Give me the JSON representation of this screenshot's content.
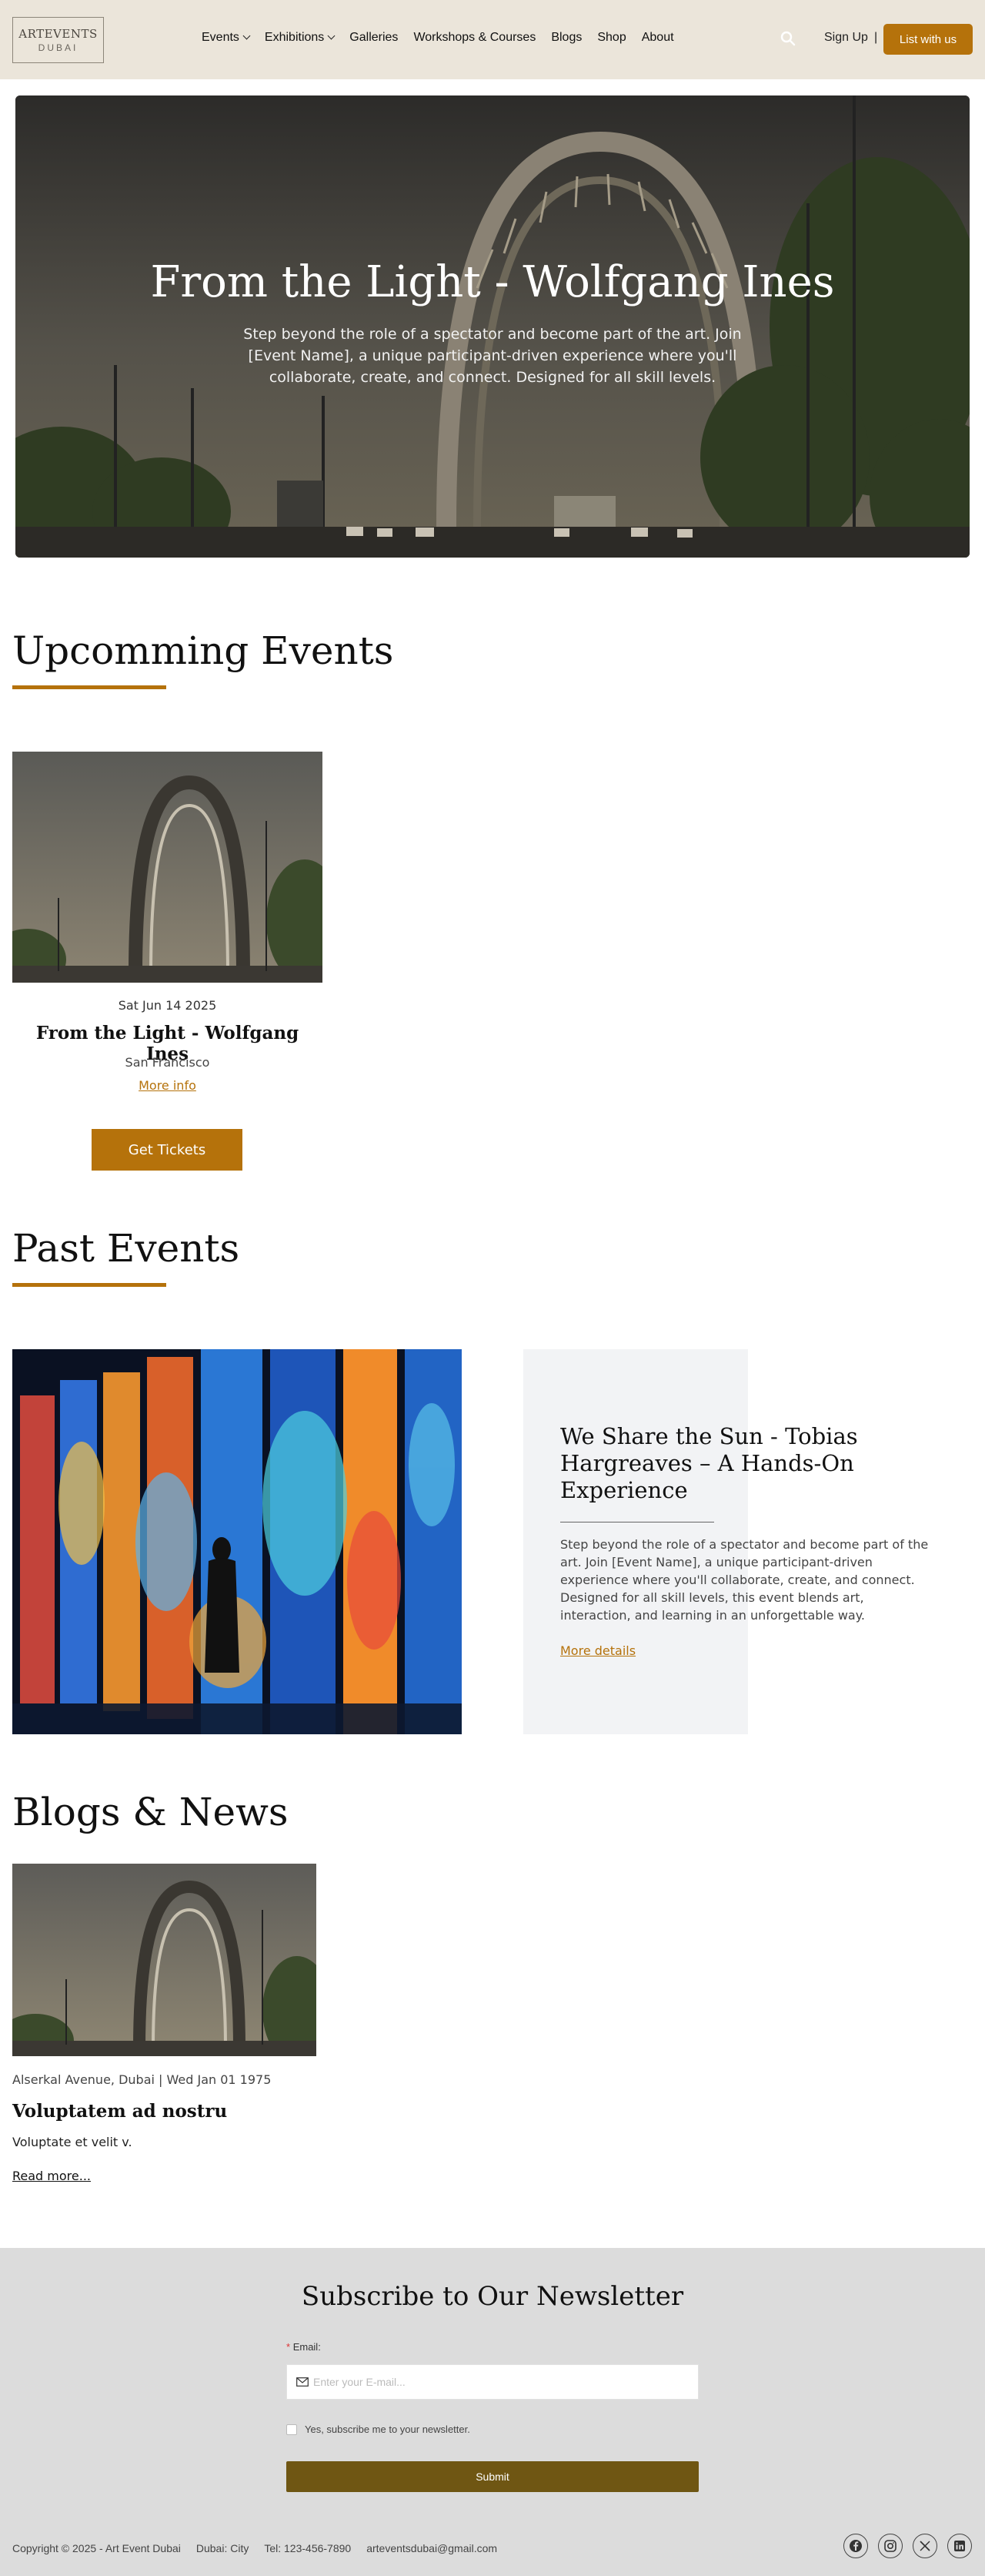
{
  "header": {
    "logo_line1": "ARTEVENTS",
    "logo_line2": "DUBAI",
    "nav": [
      "Events",
      "Exhibitions",
      "Galleries",
      "Workshops & Courses",
      "Blogs",
      "Shop",
      "About"
    ],
    "sign_up": "Sign Up",
    "separator": "|",
    "list_with_us": "List with us"
  },
  "hero": {
    "title": "From the Light - Wolfgang Ines",
    "subtitle": "Step beyond the role of a spectator and become part of the art. Join [Event Name], a unique participant-driven experience where you'll collaborate, create, and connect. Designed for all skill levels."
  },
  "upcoming": {
    "heading": "Upcomming Events",
    "card": {
      "date": "Sat Jun 14 2025",
      "title": "From the Light - Wolfgang Ines",
      "location": "San Francisco",
      "more": "More info",
      "button": "Get Tickets"
    }
  },
  "past": {
    "heading": "Past Events",
    "title": "We Share the Sun - Tobias Hargreaves – A Hands-On Experience",
    "description": "Step beyond the role of a spectator and become part of the art.  Join [Event Name], a unique participant-driven experience where you'll collaborate, create, and connect. Designed for all skill levels, this event blends art, interaction, and learning in an unforgettable way.",
    "more": "More details"
  },
  "blogs": {
    "heading": "Blogs & News",
    "meta": "Alserkal Avenue, Dubai | Wed Jan 01 1975",
    "title": "Voluptatem ad nostru",
    "excerpt": "Voluptate et velit v.",
    "read_more": "Read more..."
  },
  "newsletter": {
    "title": "Subscribe to Our Newsletter",
    "required_mark": "*",
    "email_label": "Email:",
    "email_placeholder": "Enter your E-mail...",
    "checkbox_label": "Yes, subscribe me to your newsletter.",
    "submit": "Submit"
  },
  "footer": {
    "copyright": "Copyright © 2025 - Art Event Dubai",
    "city": "Dubai: City",
    "tel": "Tel: 123-456-7890",
    "email": "arteventsdubai@gmail.com",
    "social_icons": [
      "facebook-icon",
      "instagram-icon",
      "x-icon",
      "linkedin-icon"
    ]
  },
  "colors": {
    "accent": "#b5720b",
    "header_bg": "#ebe5da",
    "newsletter_bg": "#dcdcdc",
    "submit_bg": "#6f5613"
  }
}
